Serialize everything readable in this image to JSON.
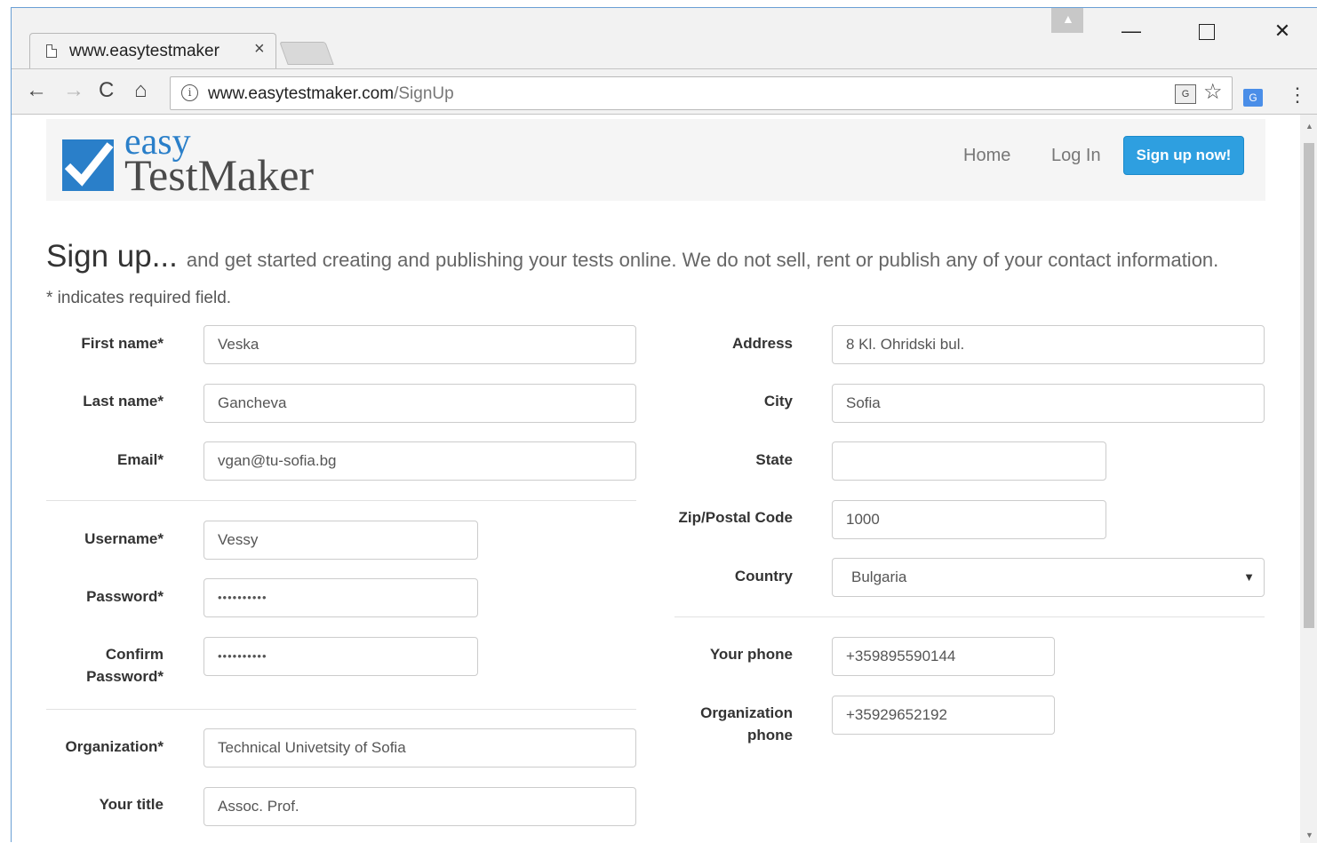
{
  "browser": {
    "tab_title": "www.easytestmaker",
    "tab_close": "×",
    "url_domain": "www.easytestmaker.com",
    "url_path": "/SignUp",
    "controls": {
      "minimize": "—",
      "close": "✕"
    }
  },
  "icons": {
    "back": "←",
    "forward": "→",
    "reload": "C",
    "home": "⌂",
    "info": "i",
    "star": "☆",
    "menu": "⋮",
    "translate": "G",
    "ext": "G"
  },
  "site": {
    "logo_easy": "easy",
    "logo_testmaker": "TestMaker",
    "nav": {
      "home": "Home",
      "login": "Log In",
      "signup": "Sign up now!"
    }
  },
  "form": {
    "heading": "Sign up...",
    "subheading": "and get started creating and publishing your tests online. We do not sell, rent or publish any of your contact information.",
    "required_note": "* indicates required field.",
    "first_name": {
      "label": "First name*",
      "value": "Veska"
    },
    "last_name": {
      "label": "Last name*",
      "value": "Gancheva"
    },
    "email": {
      "label": "Email*",
      "value": "vgan@tu-sofia.bg"
    },
    "username": {
      "label": "Username*",
      "value": "Vessy"
    },
    "password": {
      "label": "Password*",
      "value": "••••••••••"
    },
    "confirm_password": {
      "label_line1": "Confirm",
      "label_line2": "Password*",
      "value": "••••••••••"
    },
    "organization": {
      "label": "Organization*",
      "value": "Technical Univetsity of Sofia"
    },
    "your_title": {
      "label": "Your title",
      "value": "Assoc. Prof."
    },
    "address": {
      "label": "Address",
      "value": "8 Kl. Ohridski bul."
    },
    "city": {
      "label": "City",
      "value": "Sofia"
    },
    "state": {
      "label": "State",
      "value": ""
    },
    "zip": {
      "label": "Zip/Postal Code",
      "value": "1000"
    },
    "country": {
      "label": "Country",
      "value": "Bulgaria",
      "arrow": "▼"
    },
    "phone": {
      "label": "Your phone",
      "value": "+359895590144"
    },
    "org_phone": {
      "label_line1": "Organization",
      "label_line2": "phone",
      "value": "+35929652192"
    }
  },
  "colors": {
    "accent": "#2e9fe0",
    "logo_blue": "#2a7fc9"
  }
}
